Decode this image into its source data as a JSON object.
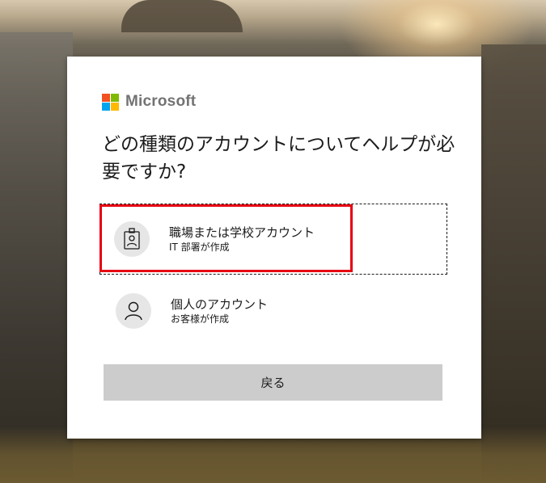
{
  "brand": {
    "name": "Microsoft",
    "logo_colors": [
      "#f25022",
      "#7fba00",
      "#00a4ef",
      "#ffb900"
    ]
  },
  "dialog": {
    "title": "どの種類のアカウントについてヘルプが必要ですか?",
    "options": [
      {
        "title": "職場または学校アカウント",
        "subtitle": "IT 部署が作成",
        "icon": "id-badge-icon",
        "selected": true
      },
      {
        "title": "個人のアカウント",
        "subtitle": "お客様が作成",
        "icon": "person-icon",
        "selected": false
      }
    ],
    "back_label": "戻る"
  },
  "annotation": {
    "highlight_color": "#e60012",
    "target": "work-or-school-account-option"
  }
}
